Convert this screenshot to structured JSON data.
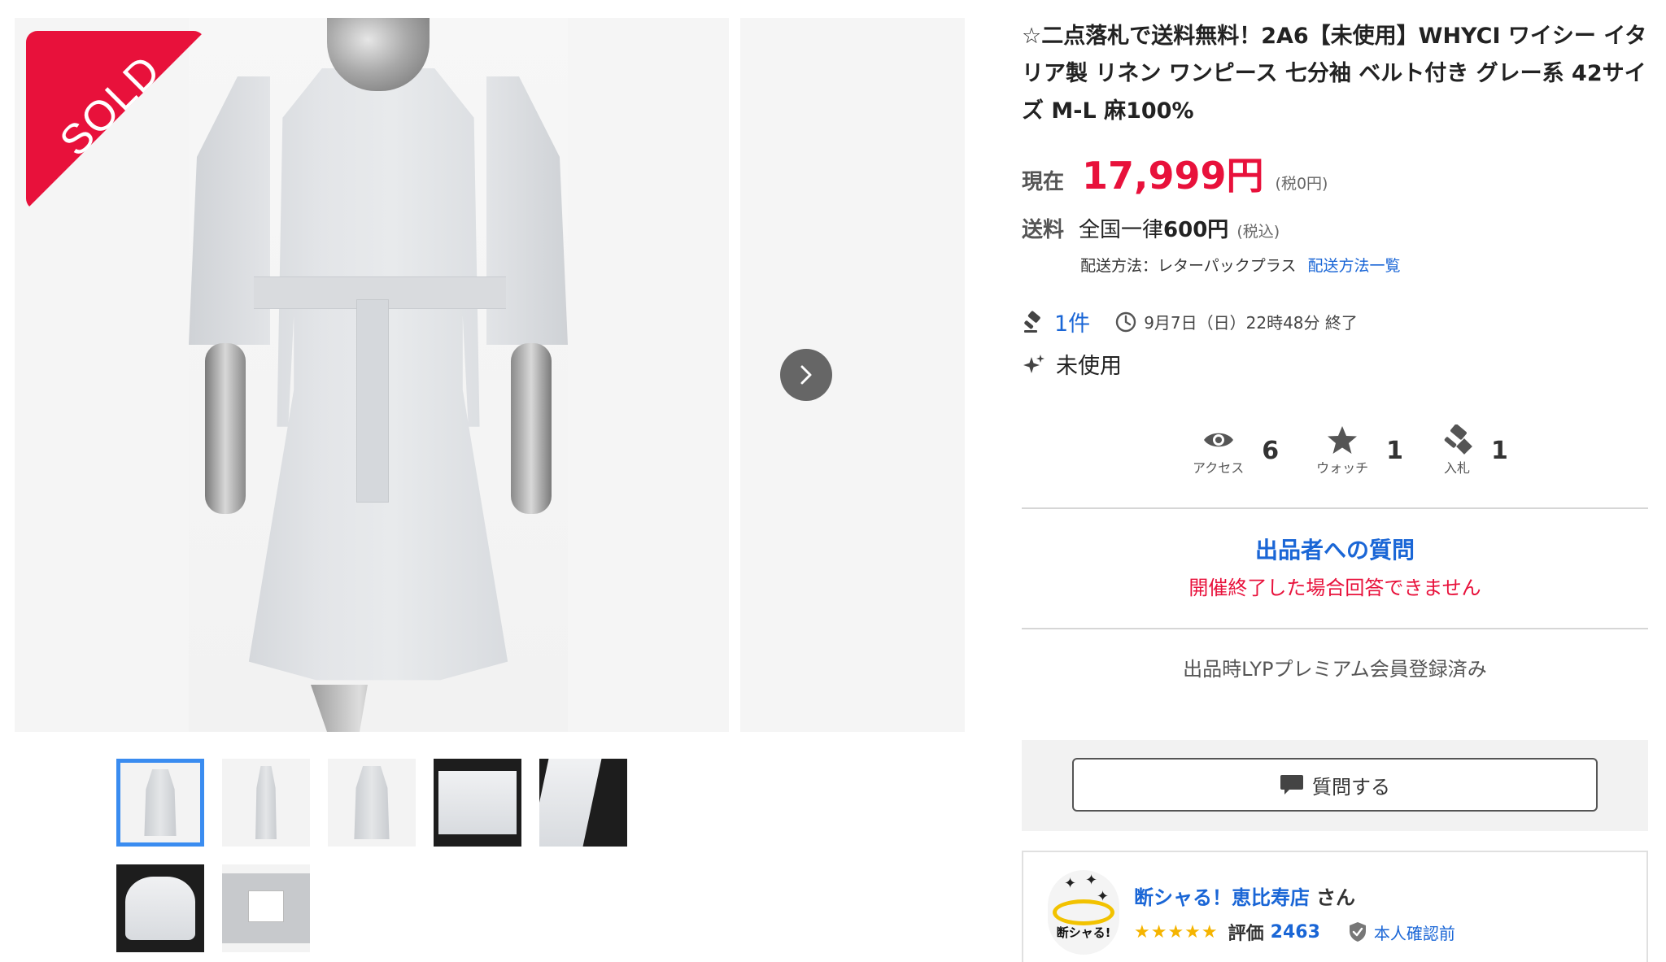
{
  "gallery": {
    "sold_badge": "SOLD",
    "next_icon": "chevron-right-icon",
    "thumbnail_count": 7
  },
  "item": {
    "title": "☆二点落札で送料無料！2A6【未使用】WHYCI ワイシー イタリア製 リネン ワンピース 七分袖 ベルト付き グレー系 42サイズ M-L 麻100%",
    "price_label": "現在",
    "price_value": "17,999円",
    "price_tax": "(税0円)",
    "shipping_label": "送料",
    "shipping_prefix": "全国一律",
    "shipping_value": "600円",
    "shipping_tax": "(税込)",
    "shipping_method_label": "配送方法：レターパックプラス",
    "shipping_method_link": "配送方法一覧",
    "bid_count": "1件",
    "end_time": "9月7日（日）22時48分 終了",
    "condition": "未使用"
  },
  "stats": {
    "access_label": "アクセス",
    "access_value": "6",
    "watch_label": "ウォッチ",
    "watch_value": "1",
    "bid_label": "入札",
    "bid_value": "1"
  },
  "question": {
    "title": "出品者への質問",
    "note": "開催終了した場合回答できません",
    "lyp_note": "出品時LYPプレミアム会員登録済み",
    "ask_button": "質問する"
  },
  "seller": {
    "avatar_text": "断シャる!",
    "name": "断シャる！恵比寿店",
    "suffix": "さん",
    "stars": "★★★★★",
    "rating_label": "評価",
    "rating_value": "2463",
    "verification": "本人確認前"
  },
  "colors": {
    "accent_red": "#e8113b",
    "link_blue": "#1a66d6",
    "thumb_active": "#3a8cf0",
    "star_yellow": "#f5b400"
  }
}
